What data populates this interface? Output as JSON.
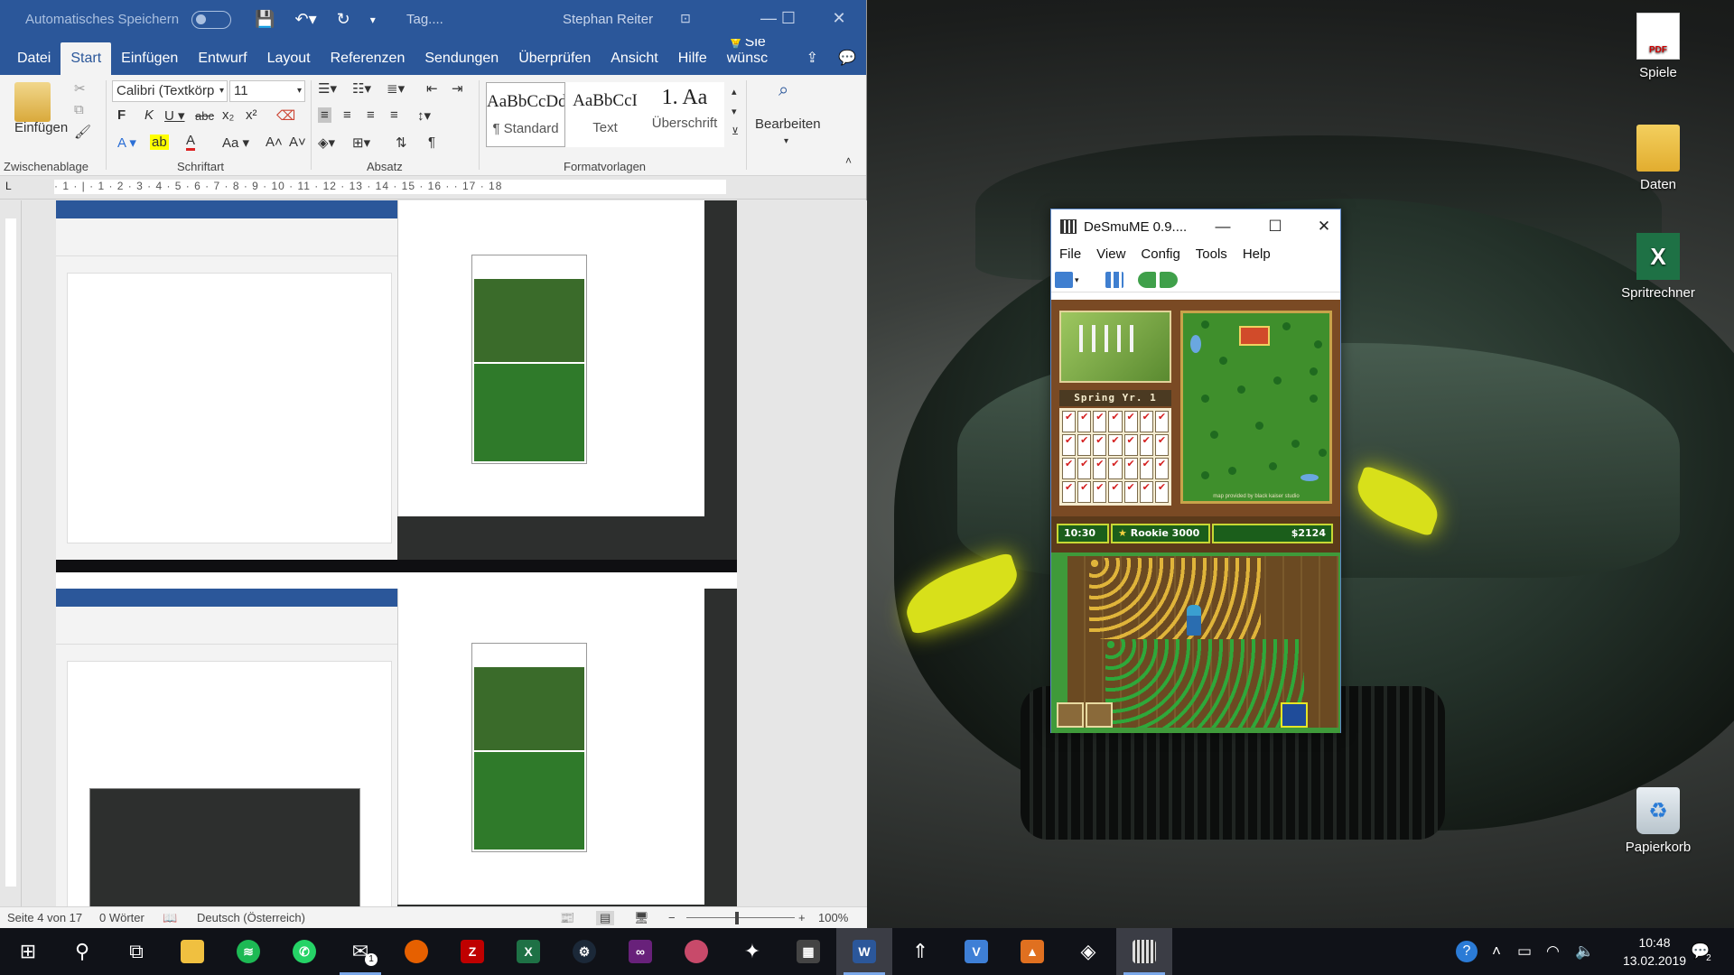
{
  "word": {
    "autosave_label": "Automatisches Speichern",
    "doc_title": "Tag....",
    "user": "Stephan Reiter",
    "tabs": [
      "Datei",
      "Start",
      "Einfügen",
      "Entwurf",
      "Layout",
      "Referenzen",
      "Sendungen",
      "Überprüfen",
      "Ansicht",
      "Hilfe",
      "Sie wünsc"
    ],
    "ribbon": {
      "paste": "Einfügen",
      "font_name": "Calibri (Textkörp",
      "font_size": "11",
      "styles": [
        {
          "preview": "AaBbCcDd",
          "name": "¶ Standard"
        },
        {
          "preview": "AaBbCcI",
          "name": "Text"
        },
        {
          "preview": "1.  Aa",
          "name": "Überschrift"
        }
      ],
      "edit": "Bearbeiten",
      "groups": [
        "Zwischenablage",
        "Schriftart",
        "Absatz",
        "Formatvorlagen"
      ]
    },
    "ruler_text": "· 1 · | · 1 · 2 · 3 · 4 · 5 · 6 · 7 · 8 · 9 · 10 · 11 · 12 · 13 · 14 · 15 · 16 ·    · 17 · 18",
    "status": {
      "page": "Seite 4 von 17",
      "words": "0 Wörter",
      "language": "Deutsch (Österreich)",
      "zoom": "100%"
    }
  },
  "desktop_icons": [
    "Spiele",
    "Daten",
    "Spritrechner",
    "Papierkorb"
  ],
  "emulator": {
    "title": "DeSmuME 0.9....",
    "menu": [
      "File",
      "View",
      "Config",
      "Tools",
      "Help"
    ],
    "game": {
      "season": "Spring  Yr. 1",
      "time": "10:30",
      "rank": "Rookie 3000",
      "money": "$2124",
      "credit": "map provided by black kaiser studio"
    }
  },
  "taskbar": {
    "time": "10:48",
    "date": "13.02.2019",
    "notifications": "2"
  }
}
